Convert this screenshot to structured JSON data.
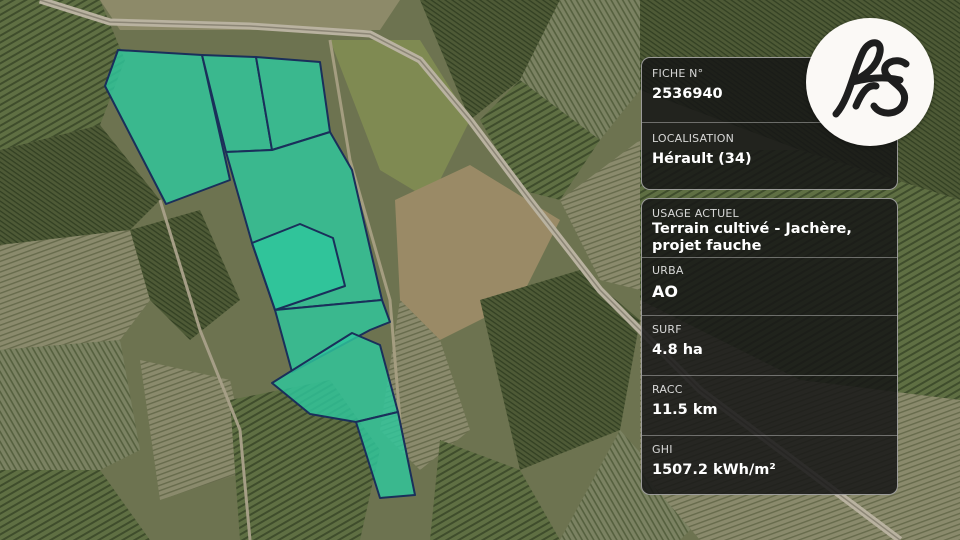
{
  "brand": {
    "logo_text": "fs",
    "logo_icon": "fs-monogram-logo"
  },
  "map": {
    "parcel_fill": "#2ec79c",
    "parcel_stroke": "#1a2f5a"
  },
  "fiche": {
    "label": "FICHE N°",
    "value": "2536940"
  },
  "localisation": {
    "label": "LOCALISATION",
    "value": "Hérault (34)"
  },
  "usage": {
    "label": "USAGE ACTUEL",
    "value": "Terrain cultivé - Jachère, projet fauche"
  },
  "urba": {
    "label": "URBA",
    "value": "AO"
  },
  "surf": {
    "label": "SURF",
    "value": "4.8 ha"
  },
  "racc": {
    "label": "RACC",
    "value": "11.5 km"
  },
  "ghi": {
    "label": "GHI",
    "value": "1507.2 kWh/m²"
  }
}
